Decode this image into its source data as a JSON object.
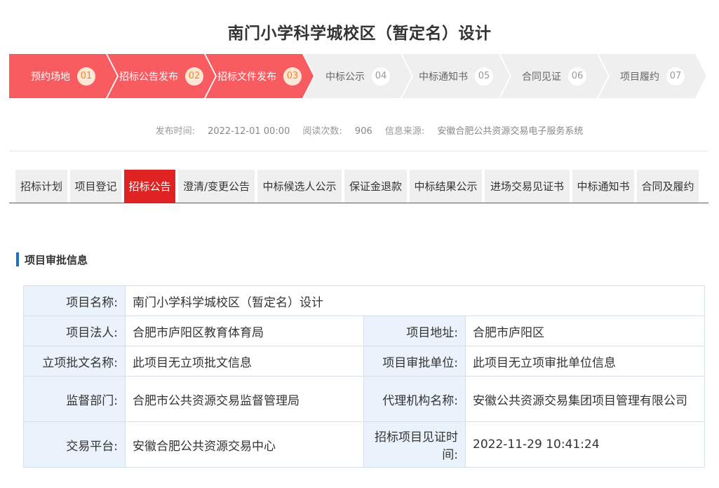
{
  "title": "南门小学科学城校区（暂定名）设计",
  "steps": [
    {
      "label": "预约场地",
      "num": "01",
      "active": true
    },
    {
      "label": "招标公告发布",
      "num": "02",
      "active": true
    },
    {
      "label": "招标文件发布",
      "num": "03",
      "active": true
    },
    {
      "label": "中标公示",
      "num": "04",
      "active": false
    },
    {
      "label": "中标通知书",
      "num": "05",
      "active": false
    },
    {
      "label": "合同见证",
      "num": "06",
      "active": false
    },
    {
      "label": "项目履约",
      "num": "07",
      "active": false
    }
  ],
  "meta": {
    "publish_label": "发布时间:",
    "publish_value": "2022-12-01 00:00",
    "reads_label": "阅读次数:",
    "reads_value": "906",
    "source_label": "信息来源:",
    "source_value": "安徽合肥公共资源交易电子服务系统"
  },
  "tabs": [
    {
      "label": "招标计划",
      "active": false
    },
    {
      "label": "项目登记",
      "active": false
    },
    {
      "label": "招标公告",
      "active": true
    },
    {
      "label": "澄清/变更公告",
      "active": false
    },
    {
      "label": "中标候选人公示",
      "active": false
    },
    {
      "label": "保证金退款",
      "active": false
    },
    {
      "label": "中标结果公示",
      "active": false
    },
    {
      "label": "进场交易见证书",
      "active": false
    },
    {
      "label": "中标通知书",
      "active": false
    },
    {
      "label": "合同及履约",
      "active": false
    }
  ],
  "section": {
    "title": "项目审批信息"
  },
  "table": {
    "project_name_label": "项目名称:",
    "project_name": "南门小学科学城校区（暂定名）设计",
    "legal_person_label": "项目法人:",
    "legal_person": "合肥市庐阳区教育体育局",
    "address_label": "项目地址:",
    "address": "合肥市庐阳区",
    "approval_doc_label": "立项批文名称:",
    "approval_doc": "此项目无立项批文信息",
    "approval_unit_label": "项目审批单位:",
    "approval_unit": "此项目无立项审批单位信息",
    "supervisor_label": "监督部门:",
    "supervisor": "合肥市公共资源交易监督管理局",
    "agency_label": "代理机构名称:",
    "agency": "安徽公共资源交易集团项目管理有限公司",
    "platform_label": "交易平台:",
    "platform": "安徽合肥公共资源交易中心",
    "witness_time_label": "招标项目见证时间:",
    "witness_time": "2022-11-29 10:41:24"
  },
  "colors": {
    "step_active": "#f85c61",
    "tab_active": "#e12222",
    "section_bar": "#1a6fc1",
    "label_bg": "#eaf2fb"
  }
}
